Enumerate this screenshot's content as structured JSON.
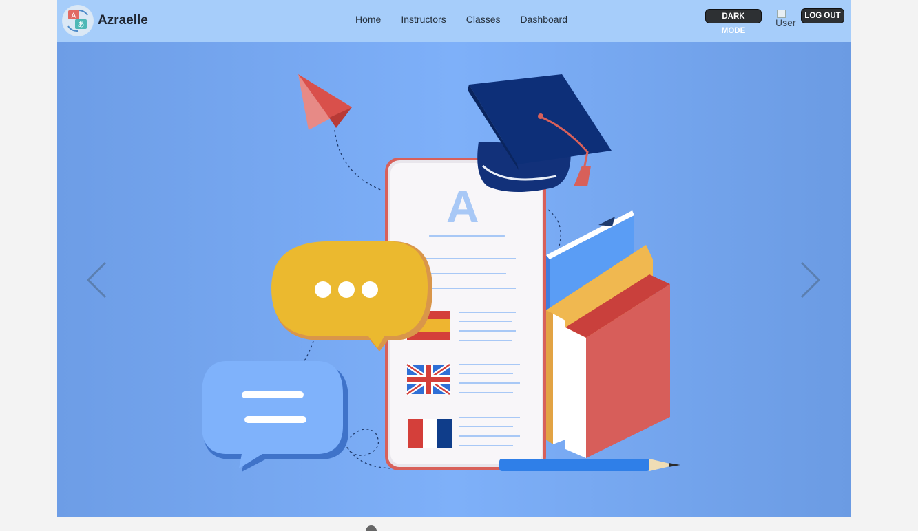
{
  "brand": {
    "name": "Azraelle",
    "logo_icon": "translate-logo-icon"
  },
  "nav": {
    "links": [
      {
        "label": "Home"
      },
      {
        "label": "Instructors"
      },
      {
        "label": "Classes"
      },
      {
        "label": "Dashboard"
      }
    ],
    "dark_mode_label": "DARK MODE",
    "user_alt": "User",
    "logout_label": "LOG OUT"
  },
  "carousel": {
    "prev_icon": "chevron-left-icon",
    "next_icon": "chevron-right-icon",
    "slide_illustration": "language-learning-illustration",
    "illustration_letter": "A"
  },
  "colors": {
    "navbar": "#a6cdfa",
    "hero_bg": "#7eb0f9",
    "button_dark": "#2d3033",
    "page_bg": "#f3f3f3"
  }
}
